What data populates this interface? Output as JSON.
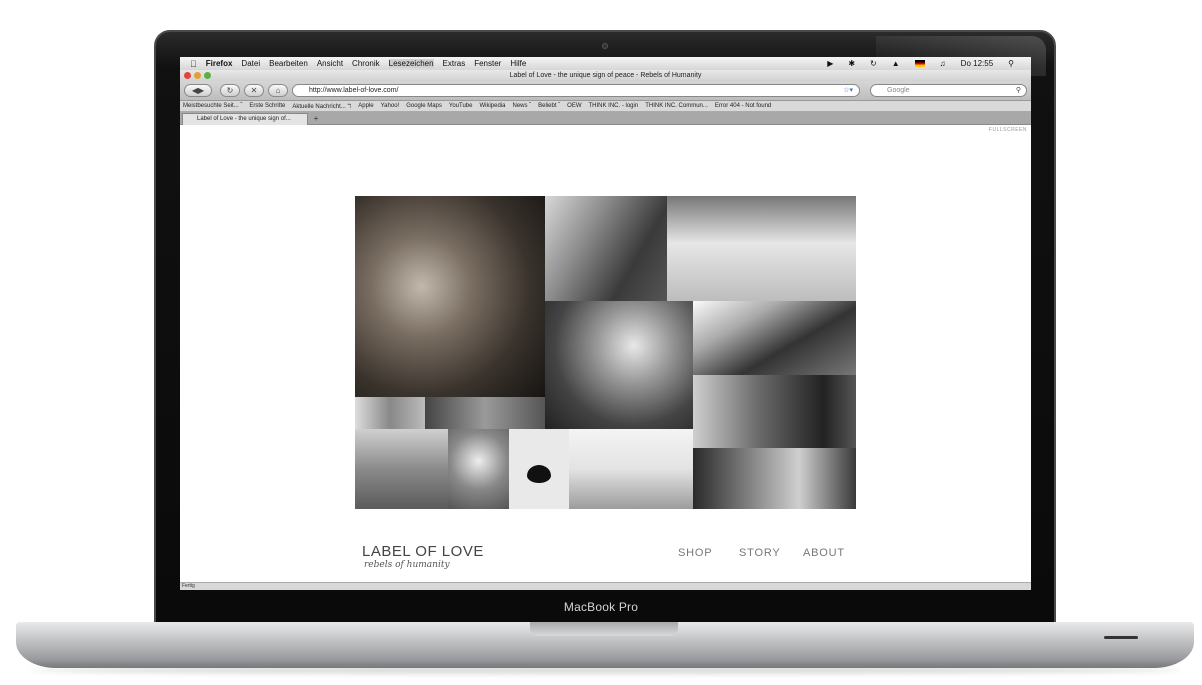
{
  "device": {
    "label": "MacBook Pro"
  },
  "menubar": {
    "app": "Firefox",
    "items": [
      "Datei",
      "Bearbeiten",
      "Ansicht",
      "Chronik",
      "Lesezeichen",
      "Extras",
      "Fenster",
      "Hilfe"
    ],
    "clock": "Do 12:55"
  },
  "window": {
    "title": "Label of Love - the unique sign of peace - Rebels of Humanity"
  },
  "toolbar": {
    "url": "http://www.label-of-love.com/",
    "search_placeholder": "Google"
  },
  "bookmarks": [
    "Meistbesuchte Seit... ˇ",
    "Erste Schritte",
    "Aktuelle Nachricht... ℸ",
    "Apple",
    "Yahoo!",
    "Google Maps",
    "YouTube",
    "Wikipedia",
    "News ˇ",
    "Beliebt ˇ",
    "OEW",
    "THINK INC. - login",
    "THINK INC. Commun...",
    "Error 404 - Not found"
  ],
  "tab": {
    "title": "Label of Love - the unique sign of..."
  },
  "page": {
    "fullscreen": "FULLSCREEN",
    "logo_main": "LABEL OF LOVE",
    "logo_sub": "rebels of humanity",
    "nav": [
      "SHOP",
      "STORY",
      "ABOUT"
    ]
  },
  "status": {
    "text": "Fertig"
  },
  "colors": {
    "close": "#e0443e",
    "minimize": "#dea236",
    "zoom": "#5bb045",
    "nav_text": "#777777"
  }
}
